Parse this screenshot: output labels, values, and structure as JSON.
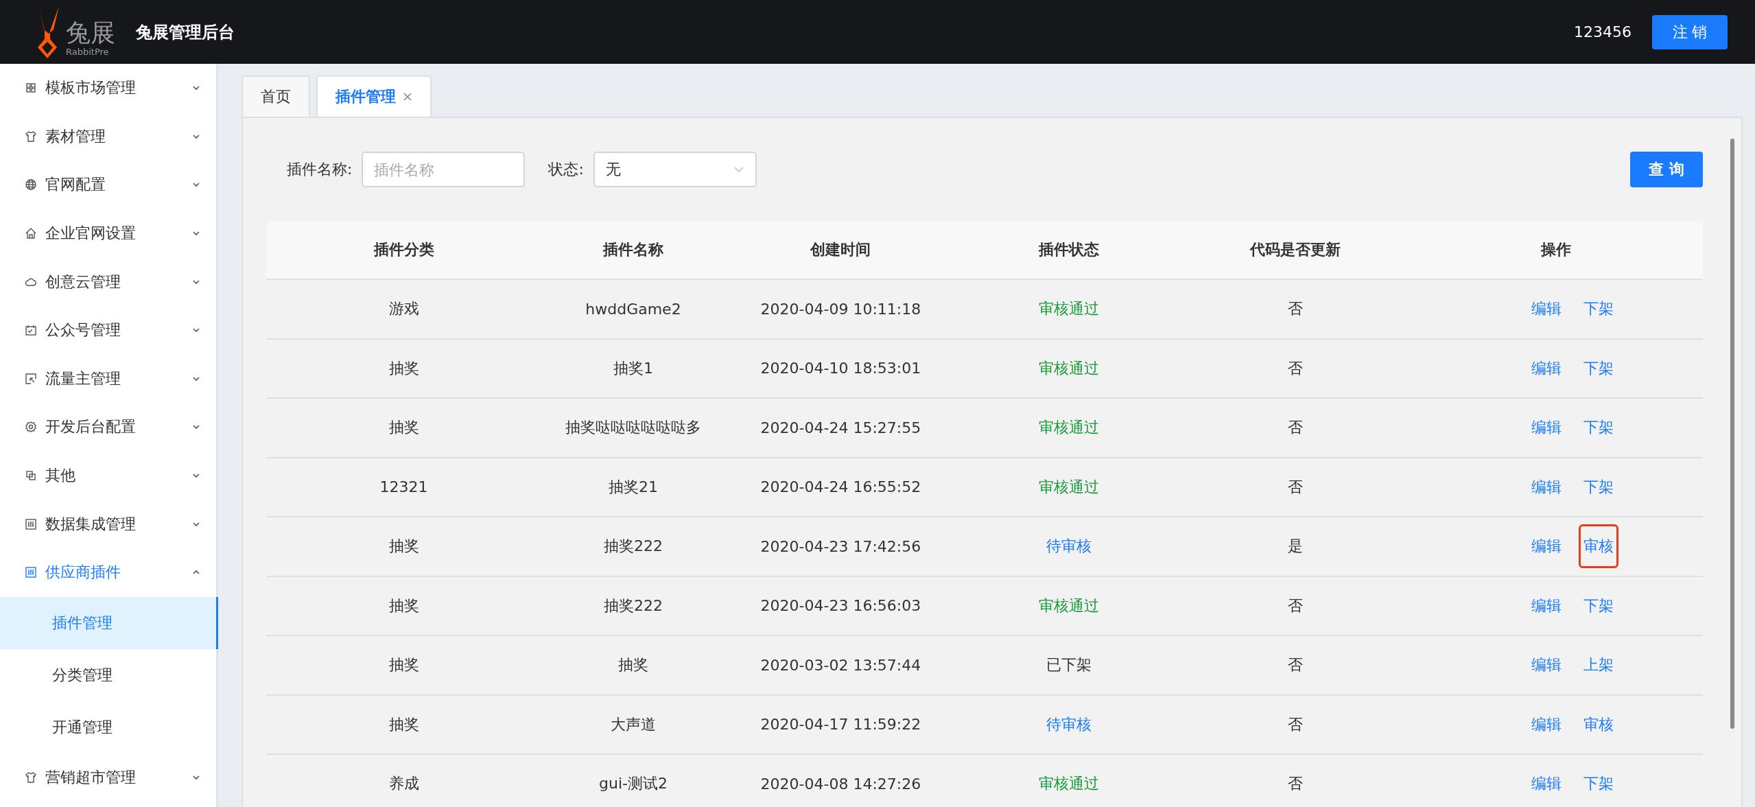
{
  "header": {
    "logo_text": "兔展",
    "logo_subtext": "RabbitPre",
    "title": "兔展管理后台",
    "user": "123456",
    "logout_button": "注 销"
  },
  "sidebar": {
    "items": [
      {
        "label": "模板市场管理",
        "expanded": false
      },
      {
        "label": "素材管理",
        "expanded": false
      },
      {
        "label": "官网配置",
        "expanded": false
      },
      {
        "label": "企业官网设置",
        "expanded": false
      },
      {
        "label": "创意云管理",
        "expanded": false
      },
      {
        "label": "公众号管理",
        "expanded": false
      },
      {
        "label": "流量主管理",
        "expanded": false
      },
      {
        "label": "开发后台配置",
        "expanded": false
      },
      {
        "label": "其他",
        "expanded": false
      },
      {
        "label": "数据集成管理",
        "expanded": false
      },
      {
        "label": "供应商插件",
        "expanded": true,
        "children": [
          {
            "label": "插件管理",
            "selected": true
          },
          {
            "label": "分类管理",
            "selected": false
          },
          {
            "label": "开通管理",
            "selected": false
          }
        ]
      },
      {
        "label": "营销超市管理",
        "expanded": false
      }
    ]
  },
  "tabs": [
    {
      "label": "首页",
      "selected": false,
      "closable": false
    },
    {
      "label": "插件管理",
      "selected": true,
      "closable": true
    }
  ],
  "filters": {
    "name_label": "插件名称:",
    "name_placeholder": "插件名称",
    "status_label": "状态:",
    "status_value": "无",
    "query_button": "查 询"
  },
  "table": {
    "columns": [
      "插件分类",
      "插件名称",
      "创建时间",
      "插件状态",
      "代码是否更新",
      "操作"
    ],
    "rows": [
      {
        "category": "游戏",
        "name": "hwddGame2",
        "created": "2020-04-09 10:11:18",
        "status": "审核通过",
        "color": "#179a3a",
        "updated": "否",
        "actions": [
          {
            "label": "编辑",
            "highlighted": false
          },
          {
            "label": "下架",
            "highlighted": false
          }
        ]
      },
      {
        "category": "抽奖",
        "name": "抽奖1",
        "created": "2020-04-10 18:53:01",
        "status": "审核通过",
        "color": "#179a3a",
        "updated": "否",
        "actions": [
          {
            "label": "编辑",
            "highlighted": false
          },
          {
            "label": "下架",
            "highlighted": false
          }
        ]
      },
      {
        "category": "抽奖",
        "name": "抽奖哒哒哒哒哒哒多",
        "created": "2020-04-24 15:27:55",
        "status": "审核通过",
        "color": "#179a3a",
        "updated": "否",
        "actions": [
          {
            "label": "编辑",
            "highlighted": false
          },
          {
            "label": "下架",
            "highlighted": false
          }
        ]
      },
      {
        "category": "12321",
        "name": "抽奖21",
        "created": "2020-04-24 16:55:52",
        "status": "审核通过",
        "color": "#179a3a",
        "updated": "否",
        "actions": [
          {
            "label": "编辑",
            "highlighted": false
          },
          {
            "label": "下架",
            "highlighted": false
          }
        ]
      },
      {
        "category": "抽奖",
        "name": "抽奖222",
        "created": "2020-04-23 17:42:56",
        "status": "待审核",
        "color": "#1a7bff",
        "updated": "是",
        "actions": [
          {
            "label": "编辑",
            "highlighted": false
          },
          {
            "label": "审核",
            "highlighted": true
          }
        ]
      },
      {
        "category": "抽奖",
        "name": "抽奖222",
        "created": "2020-04-23 16:56:03",
        "status": "审核通过",
        "color": "#179a3a",
        "updated": "否",
        "actions": [
          {
            "label": "编辑",
            "highlighted": false
          },
          {
            "label": "下架",
            "highlighted": false
          }
        ]
      },
      {
        "category": "抽奖",
        "name": "抽奖",
        "created": "2020-03-02 13:57:44",
        "status": "已下架",
        "color": "#333333",
        "updated": "否",
        "actions": [
          {
            "label": "编辑",
            "highlighted": false
          },
          {
            "label": "上架",
            "highlighted": false
          }
        ]
      },
      {
        "category": "抽奖",
        "name": "大声道",
        "created": "2020-04-17 11:59:22",
        "status": "待审核",
        "color": "#1a7bff",
        "updated": "否",
        "actions": [
          {
            "label": "编辑",
            "highlighted": false
          },
          {
            "label": "审核",
            "highlighted": false
          }
        ]
      },
      {
        "category": "养成",
        "name": "gui-测试2",
        "created": "2020-04-08 14:27:26",
        "status": "审核通过",
        "color": "#179a3a",
        "updated": "否",
        "actions": [
          {
            "label": "编辑",
            "highlighted": false
          },
          {
            "label": "下架",
            "highlighted": false
          }
        ]
      }
    ]
  }
}
